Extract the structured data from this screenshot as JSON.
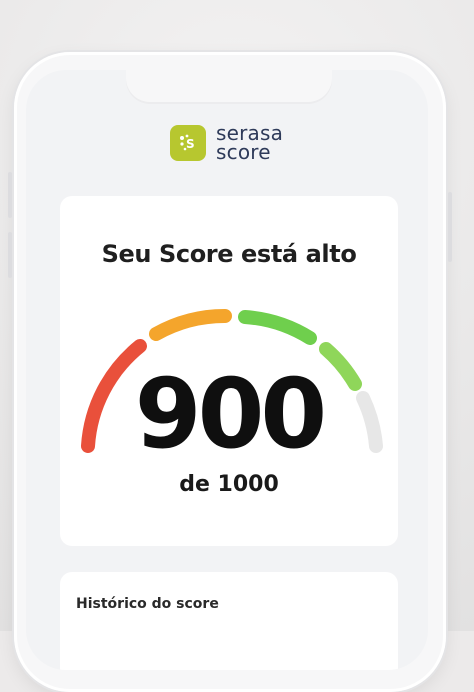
{
  "brand": {
    "name_line1": "serasa",
    "name_line2": "score",
    "logo_icon": "serasa-logo-icon",
    "logo_color": "#b7c72f",
    "text_color": "#2e3a59"
  },
  "score_card": {
    "title": "Seu Score está alto",
    "score": "900",
    "max_label": "de 1000",
    "score_value": 900,
    "score_max": 1000,
    "gauge_segments": [
      {
        "name": "red",
        "color": "#e9503b"
      },
      {
        "name": "orange",
        "color": "#f4a52c"
      },
      {
        "name": "green",
        "color": "#6fcf4d"
      },
      {
        "name": "light-green",
        "color": "#8fd65a"
      },
      {
        "name": "empty",
        "color": "#e7e7e7"
      }
    ]
  },
  "history": {
    "title": "Histórico do score"
  }
}
